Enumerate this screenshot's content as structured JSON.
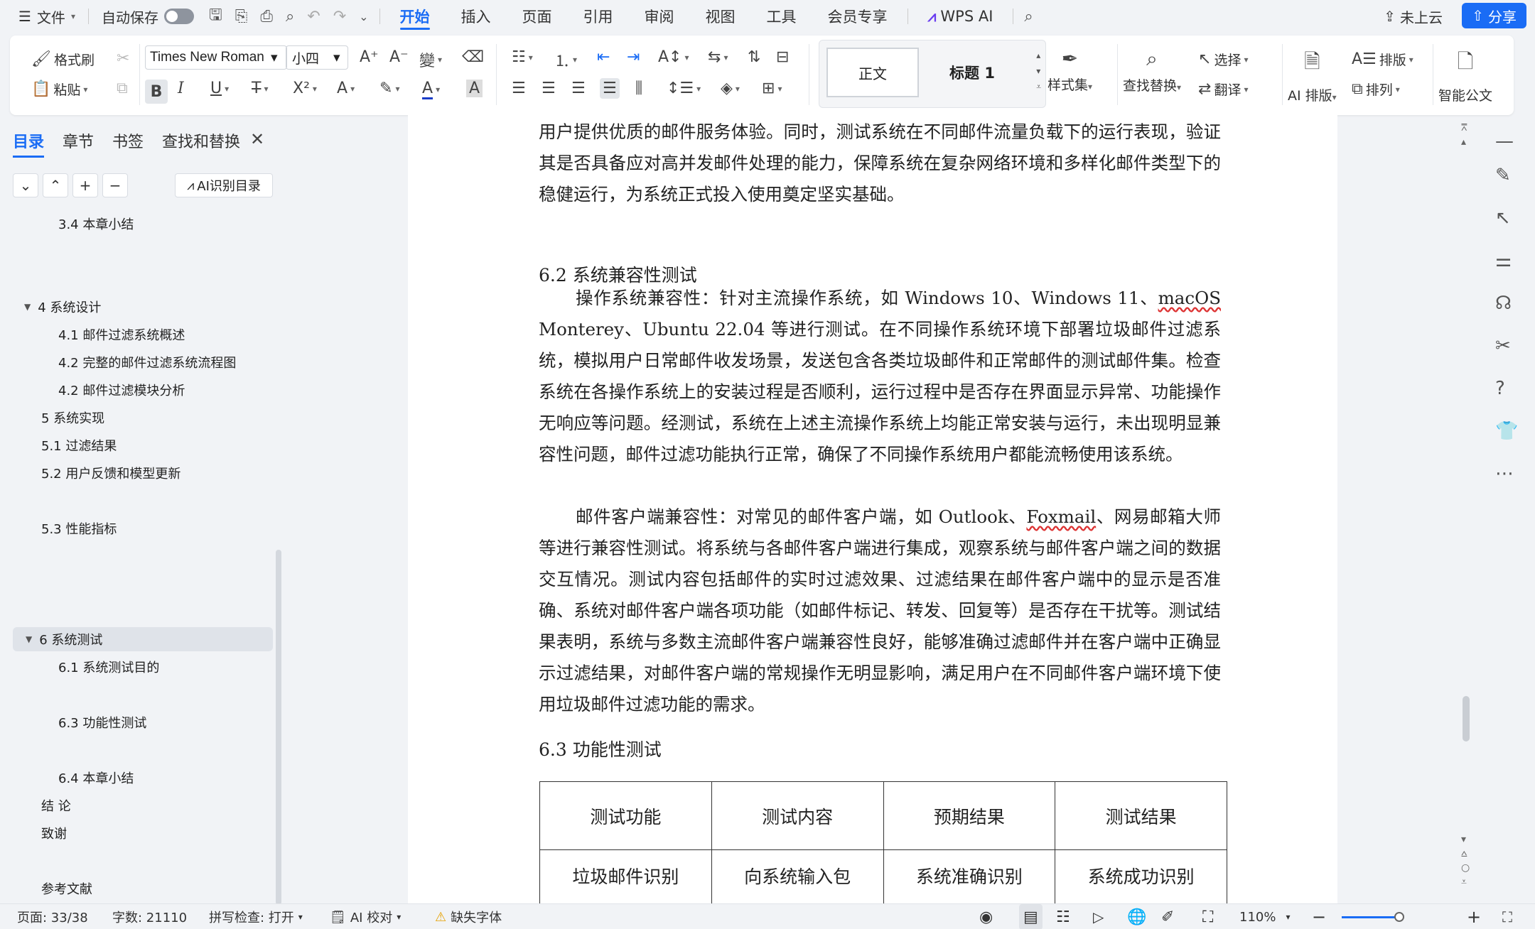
{
  "menubar": {
    "file": "文件",
    "autosave": "自动保存",
    "tabs": [
      "开始",
      "插入",
      "页面",
      "引用",
      "审阅",
      "视图",
      "工具",
      "会员专享"
    ],
    "active_tab": "开始",
    "wps_ai": "WPS AI",
    "cloud": "未上云",
    "share": "分享"
  },
  "ribbon": {
    "format_painter": "格式刷",
    "paste": "粘贴",
    "font_name": "Times New Roman",
    "font_size": "小四",
    "style_normal": "正文",
    "style_heading": "标题 1",
    "style_set": "样式集",
    "find_replace": "查找替换",
    "select": "选择",
    "translate": "翻译",
    "ai_layout": "AI 排版",
    "typeset": "排版",
    "arrange": "排列",
    "smart_doc": "智能公文"
  },
  "panel": {
    "tabs": [
      "目录",
      "章节",
      "书签",
      "查找和替换"
    ],
    "active_tab": "目录",
    "ai_toc": "AI识别目录",
    "toc": [
      {
        "text": "3.4 本章小结",
        "level": 2
      },
      {
        "text": "4  系统设计",
        "level": 1,
        "arrow": "▼"
      },
      {
        "text": "4.1  邮件过滤系统概述",
        "level": 2
      },
      {
        "text": "4.2  完整的邮件过滤系统流程图",
        "level": 2
      },
      {
        "text": "4.2    邮件过滤模块分析",
        "level": 2
      },
      {
        "text": "5 系统实现",
        "level": 1
      },
      {
        "text": "5.1  过滤结果",
        "level": 1
      },
      {
        "text": "5.2  用户反馈和模型更新",
        "level": 1
      },
      {
        "text": "5.3  性能指标",
        "level": 1
      },
      {
        "text": "6  系统测试",
        "level": 1,
        "arrow": "▼",
        "selected": true
      },
      {
        "text": "6.1  系统测试目的",
        "level": 2
      },
      {
        "text": "6.3  功能性测试",
        "level": 2
      },
      {
        "text": "6.4  本章小结",
        "level": 2
      },
      {
        "text": "结   论",
        "level": 1
      },
      {
        "text": "致谢",
        "level": 1
      },
      {
        "text": "参考文献",
        "level": 1
      }
    ]
  },
  "document": {
    "para_top": "用户提供优质的邮件服务体验。同时，测试系统在不同邮件流量负载下的运行表现，验证其是否具备应对高并发邮件处理的能力，保障系统在复杂网络环境和多样化邮件类型下的稳健运行，为系统正式投入使用奠定坚实基础。",
    "h_62": "6.2  系统兼容性测试",
    "para_os_1": "操作系统兼容性：针对主流操作系统，如 Windows 10、Windows 11、",
    "para_os_mac": "macOS",
    "para_os_2": "Monterey、Ubuntu 22.04 等进行测试。在不同操作系统环境下部署垃圾邮件过滤系统，模拟用户日常邮件收发场景，发送包含各类垃圾邮件和正常邮件的测试邮件集。检查系统在各操作系统上的安装过程是否顺利，运行过程中是否存在界面显示异常、功能操作无响应等问题。经测试，系统在上述主流操作系统上均能正常安装与运行，未出现明显兼容性问题，邮件过滤功能执行正常，确保了不同操作系统用户都能流畅使用该系统。",
    "para_client_1": "邮件客户端兼容性：对常见的邮件客户端，如 Outlook、",
    "para_client_foxmail": "Foxmail",
    "para_client_2": "、网易邮箱大师等进行兼容性测试。将系统与各邮件客户端进行集成，观察系统与邮件客户端之间的数据交互情况。测试内容包括邮件的实时过滤效果、过滤结果在邮件客户端中的显示是否准确、系统对邮件客户端各项功能（如邮件标记、转发、回复等）是否存在干扰等。测试结果表明，系统与多数主流邮件客户端兼容性良好，能够准确过滤邮件并在客户端中正确显示过滤结果，对邮件客户端的常规操作无明显影响，满足用户在不同邮件客户端环境下使用垃圾邮件过滤功能的需求。",
    "h_63": "6.3  功能性测试",
    "table_headers": [
      "测试功能",
      "测试内容",
      "预期结果",
      "测试结果"
    ],
    "table_row1": [
      "垃圾邮件识别",
      "向系统输入包",
      "系统准确识别",
      "系统成功识别"
    ]
  },
  "status": {
    "page": "页面: 33/38",
    "words": "字数: 21110",
    "spell": "拼写检查: 打开",
    "ai_check": "AI 校对",
    "missing_font": "缺失字体",
    "zoom": "110%"
  },
  "colors": {
    "accent": "#1a6cf5",
    "share_bg": "#1a6cf5"
  }
}
